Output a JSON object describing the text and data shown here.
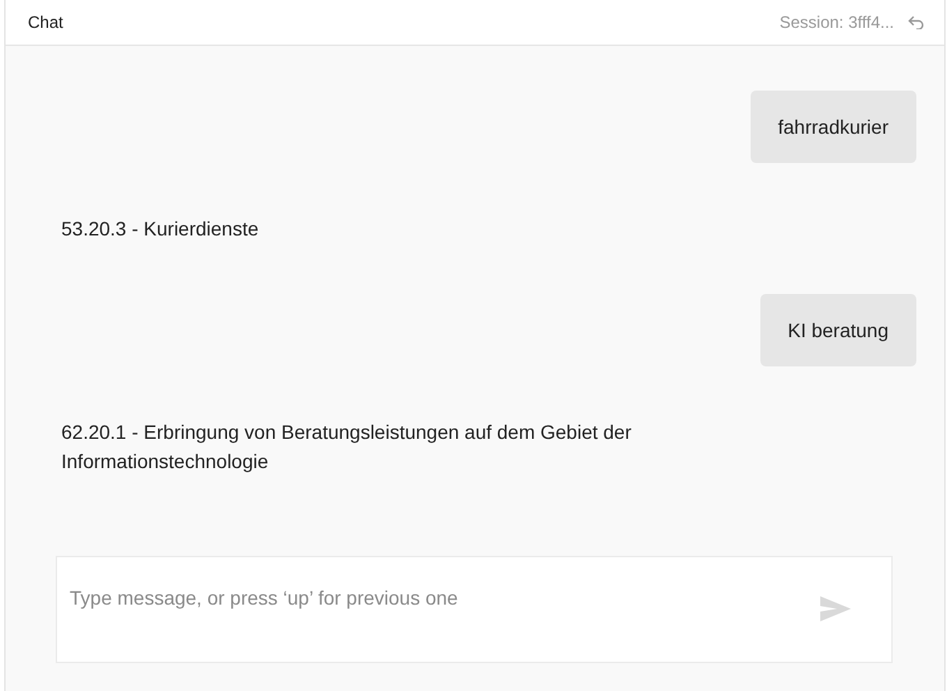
{
  "header": {
    "title": "Chat",
    "session": "Session: 3fff4..."
  },
  "messages": [
    {
      "kind": "user",
      "text": "fahrradkurier"
    },
    {
      "kind": "bot",
      "text": "53.20.3 - Kurierdienste"
    },
    {
      "kind": "user",
      "text": "KI beratung"
    },
    {
      "kind": "bot",
      "text": "62.20.1 - Erbringung von Beratungsleistungen auf dem Gebiet der Informationstechnologie"
    }
  ],
  "composer": {
    "placeholder": "Type message, or press ‘up’ for previous one"
  }
}
